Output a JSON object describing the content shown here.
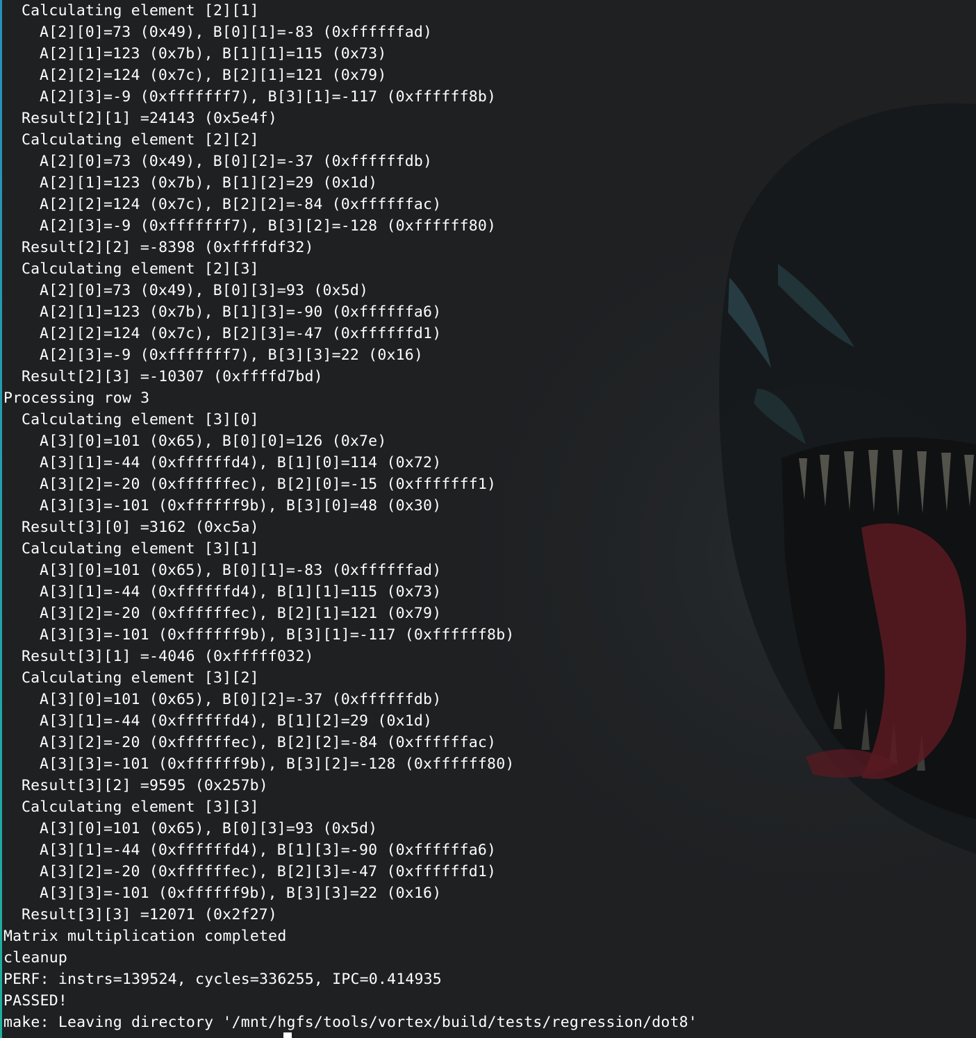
{
  "terminal": {
    "lines": [
      {
        "indent": 1,
        "text": "Calculating element [2][1]"
      },
      {
        "indent": 2,
        "text": "A[2][0]=73 (0x49), B[0][1]=-83 (0xffffffad)"
      },
      {
        "indent": 2,
        "text": "A[2][1]=123 (0x7b), B[1][1]=115 (0x73)"
      },
      {
        "indent": 2,
        "text": "A[2][2]=124 (0x7c), B[2][1]=121 (0x79)"
      },
      {
        "indent": 2,
        "text": "A[2][3]=-9 (0xfffffff7), B[3][1]=-117 (0xffffff8b)"
      },
      {
        "indent": 1,
        "text": "Result[2][1] =24143 (0x5e4f)"
      },
      {
        "indent": 1,
        "text": "Calculating element [2][2]"
      },
      {
        "indent": 2,
        "text": "A[2][0]=73 (0x49), B[0][2]=-37 (0xffffffdb)"
      },
      {
        "indent": 2,
        "text": "A[2][1]=123 (0x7b), B[1][2]=29 (0x1d)"
      },
      {
        "indent": 2,
        "text": "A[2][2]=124 (0x7c), B[2][2]=-84 (0xffffffac)"
      },
      {
        "indent": 2,
        "text": "A[2][3]=-9 (0xfffffff7), B[3][2]=-128 (0xffffff80)"
      },
      {
        "indent": 1,
        "text": "Result[2][2] =-8398 (0xffffdf32)"
      },
      {
        "indent": 1,
        "text": "Calculating element [2][3]"
      },
      {
        "indent": 2,
        "text": "A[2][0]=73 (0x49), B[0][3]=93 (0x5d)"
      },
      {
        "indent": 2,
        "text": "A[2][1]=123 (0x7b), B[1][3]=-90 (0xffffffa6)"
      },
      {
        "indent": 2,
        "text": "A[2][2]=124 (0x7c), B[2][3]=-47 (0xffffffd1)"
      },
      {
        "indent": 2,
        "text": "A[2][3]=-9 (0xfffffff7), B[3][3]=22 (0x16)"
      },
      {
        "indent": 1,
        "text": "Result[2][3] =-10307 (0xffffd7bd)"
      },
      {
        "indent": 0,
        "text": "Processing row 3"
      },
      {
        "indent": 1,
        "text": "Calculating element [3][0]"
      },
      {
        "indent": 2,
        "text": "A[3][0]=101 (0x65), B[0][0]=126 (0x7e)"
      },
      {
        "indent": 2,
        "text": "A[3][1]=-44 (0xffffffd4), B[1][0]=114 (0x72)"
      },
      {
        "indent": 2,
        "text": "A[3][2]=-20 (0xffffffec), B[2][0]=-15 (0xfffffff1)"
      },
      {
        "indent": 2,
        "text": "A[3][3]=-101 (0xffffff9b), B[3][0]=48 (0x30)"
      },
      {
        "indent": 1,
        "text": "Result[3][0] =3162 (0xc5a)"
      },
      {
        "indent": 1,
        "text": "Calculating element [3][1]"
      },
      {
        "indent": 2,
        "text": "A[3][0]=101 (0x65), B[0][1]=-83 (0xffffffad)"
      },
      {
        "indent": 2,
        "text": "A[3][1]=-44 (0xffffffd4), B[1][1]=115 (0x73)"
      },
      {
        "indent": 2,
        "text": "A[3][2]=-20 (0xffffffec), B[2][1]=121 (0x79)"
      },
      {
        "indent": 2,
        "text": "A[3][3]=-101 (0xffffff9b), B[3][1]=-117 (0xffffff8b)"
      },
      {
        "indent": 1,
        "text": "Result[3][1] =-4046 (0xfffff032)"
      },
      {
        "indent": 1,
        "text": "Calculating element [3][2]"
      },
      {
        "indent": 2,
        "text": "A[3][0]=101 (0x65), B[0][2]=-37 (0xffffffdb)"
      },
      {
        "indent": 2,
        "text": "A[3][1]=-44 (0xffffffd4), B[1][2]=29 (0x1d)"
      },
      {
        "indent": 2,
        "text": "A[3][2]=-20 (0xffffffec), B[2][2]=-84 (0xffffffac)"
      },
      {
        "indent": 2,
        "text": "A[3][3]=-101 (0xffffff9b), B[3][2]=-128 (0xffffff80)"
      },
      {
        "indent": 1,
        "text": "Result[3][2] =9595 (0x257b)"
      },
      {
        "indent": 1,
        "text": "Calculating element [3][3]"
      },
      {
        "indent": 2,
        "text": "A[3][0]=101 (0x65), B[0][3]=93 (0x5d)"
      },
      {
        "indent": 2,
        "text": "A[3][1]=-44 (0xffffffd4), B[1][3]=-90 (0xffffffa6)"
      },
      {
        "indent": 2,
        "text": "A[3][2]=-20 (0xffffffec), B[2][3]=-47 (0xffffffd1)"
      },
      {
        "indent": 2,
        "text": "A[3][3]=-101 (0xffffff9b), B[3][3]=22 (0x16)"
      },
      {
        "indent": 1,
        "text": "Result[3][3] =12071 (0x2f27)"
      },
      {
        "indent": 0,
        "text": "Matrix multiplication completed"
      },
      {
        "indent": 0,
        "text": "cleanup"
      },
      {
        "indent": 0,
        "text": "PERF: instrs=139524, cycles=336255, IPC=0.414935"
      },
      {
        "indent": 0,
        "text": "PASSED!"
      },
      {
        "indent": 0,
        "text": "make: Leaving directory '/mnt/hgfs/tools/vortex/build/tests/regression/dot8'"
      }
    ]
  },
  "colors": {
    "background": "#1e2022",
    "text": "#ffffff",
    "accent": "#2a8fb8"
  },
  "wallpaper": {
    "icon": "venom-wallpaper"
  }
}
